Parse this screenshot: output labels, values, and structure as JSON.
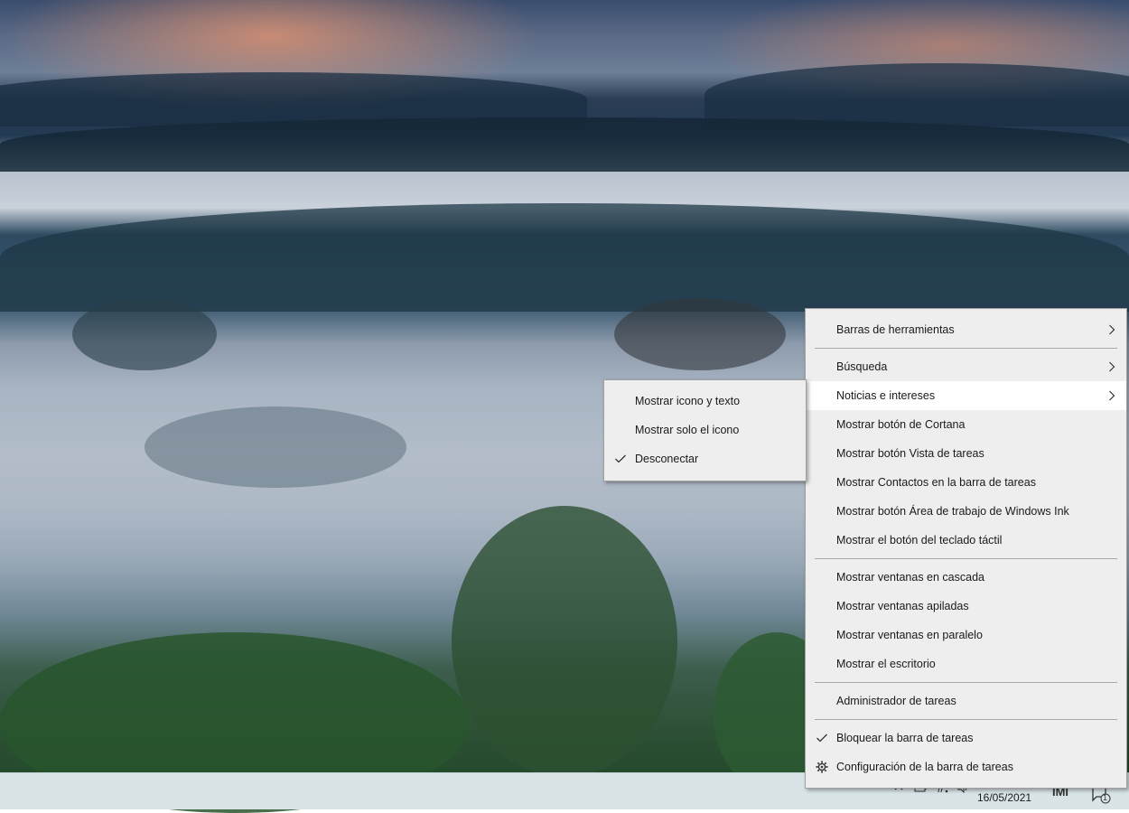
{
  "main_menu": {
    "items": [
      {
        "label": "Barras de herramientas",
        "submenu": true
      },
      {
        "label": "Búsqueda",
        "submenu": true
      },
      {
        "label": "Noticias e intereses",
        "submenu": true,
        "highlighted": true
      },
      {
        "label": "Mostrar botón de Cortana"
      },
      {
        "label": "Mostrar botón Vista de tareas"
      },
      {
        "label": "Mostrar Contactos en la barra de tareas"
      },
      {
        "label": "Mostrar botón Área de trabajo de Windows Ink"
      },
      {
        "label": "Mostrar el botón del teclado táctil"
      },
      {
        "label": "Mostrar ventanas en cascada"
      },
      {
        "label": "Mostrar ventanas apiladas"
      },
      {
        "label": "Mostrar ventanas en paralelo"
      },
      {
        "label": "Mostrar el escritorio"
      },
      {
        "label": "Administrador de tareas"
      },
      {
        "label": "Bloquear la barra de tareas",
        "checked": true
      },
      {
        "label": "Configuración de la barra de tareas",
        "icon": "gear-icon"
      }
    ]
  },
  "sub_menu": {
    "items": [
      {
        "label": "Mostrar icono y texto"
      },
      {
        "label": "Mostrar solo el icono"
      },
      {
        "label": "Desconectar",
        "checked": true
      }
    ]
  },
  "taskbar": {
    "date": "16/05/2021",
    "tray_icons": [
      "chevron-up-icon",
      "battery-icon",
      "network-icon",
      "volume-icon",
      "language-icon",
      "notification-icon"
    ],
    "notification_count": "1"
  },
  "colors": {
    "menu_bg": "#eeeeee",
    "menu_highlight": "#ffffff",
    "taskbar_bg": "#d8e4e6"
  }
}
